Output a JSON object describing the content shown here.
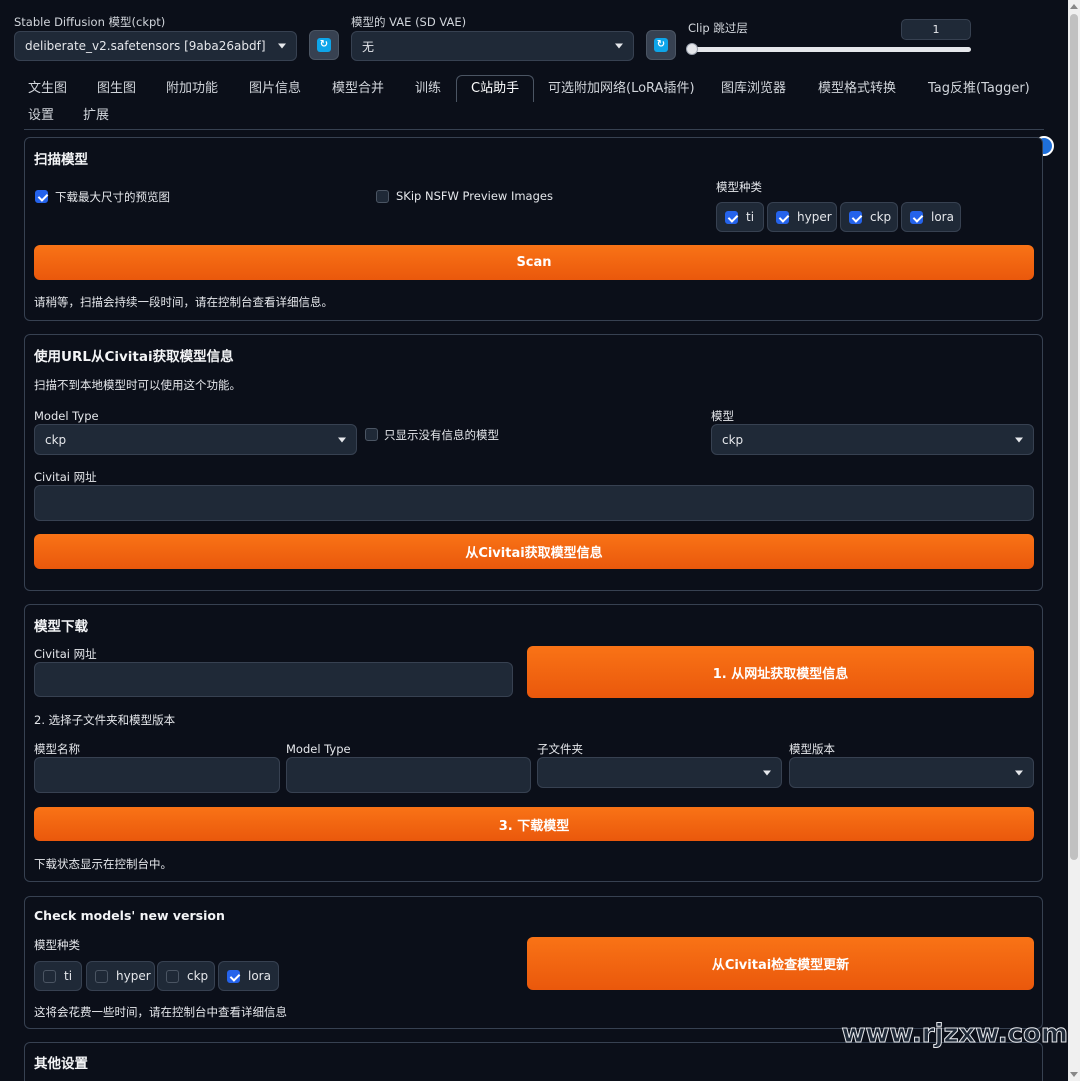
{
  "top": {
    "checkpoint_label": "Stable Diffusion 模型(ckpt)",
    "checkpoint_value": "deliberate_v2.safetensors [9aba26abdf]",
    "vae_label": "模型的 VAE (SD VAE)",
    "vae_value": "无",
    "clip_label": "Clip 跳过层",
    "clip_value": "1",
    "clip_level": 0.0
  },
  "tabs": [
    "文生图",
    "图生图",
    "附加功能",
    "图片信息",
    "模型合并",
    "训练",
    "C站助手",
    "可选附加网络(LoRA插件)",
    "图库浏览器",
    "模型格式转换",
    "Tag反推(Tagger)",
    "设置",
    "扩展"
  ],
  "active_tab": "C站助手",
  "scan": {
    "title": "扫描模型",
    "download_preview": "下载最大尺寸的预览图",
    "skip_nsfw": "SKip NSFW Preview Images",
    "types_label": "模型种类",
    "types": [
      "ti",
      "hyper",
      "ckp",
      "lora"
    ],
    "button": "Scan",
    "note": "请稍等，扫描会持续一段时间，请在控制台查看详细信息。"
  },
  "url_info": {
    "title": "使用URL从Civitai获取模型信息",
    "desc": "扫描不到本地模型时可以使用这个功能。",
    "model_type_label": "Model Type",
    "model_type_value": "ckp",
    "only_no_info": "只显示没有信息的模型",
    "model_label": "模型",
    "model_value": "ckp",
    "url_label": "Civitai 网址",
    "button": "从Civitai获取模型信息"
  },
  "download": {
    "title": "模型下载",
    "url_label": "Civitai 网址",
    "fetch_button": "1. 从网址获取模型信息",
    "step2": "2. 选择子文件夹和模型版本",
    "name_label": "模型名称",
    "type_label": "Model Type",
    "subfolder_label": "子文件夹",
    "version_label": "模型版本",
    "button": "3. 下载模型",
    "status": "下载状态显示在控制台中。"
  },
  "check": {
    "title": "Check models' new version",
    "types_label": "模型种类",
    "types": [
      "ti",
      "hyper",
      "ckp",
      "lora"
    ],
    "button": "从Civitai检查模型更新",
    "note": "这将会花费一些时间，请在控制台中查看详细信息"
  },
  "other": {
    "title": "其他设置"
  },
  "watermark": "www.rjzxw.com"
}
